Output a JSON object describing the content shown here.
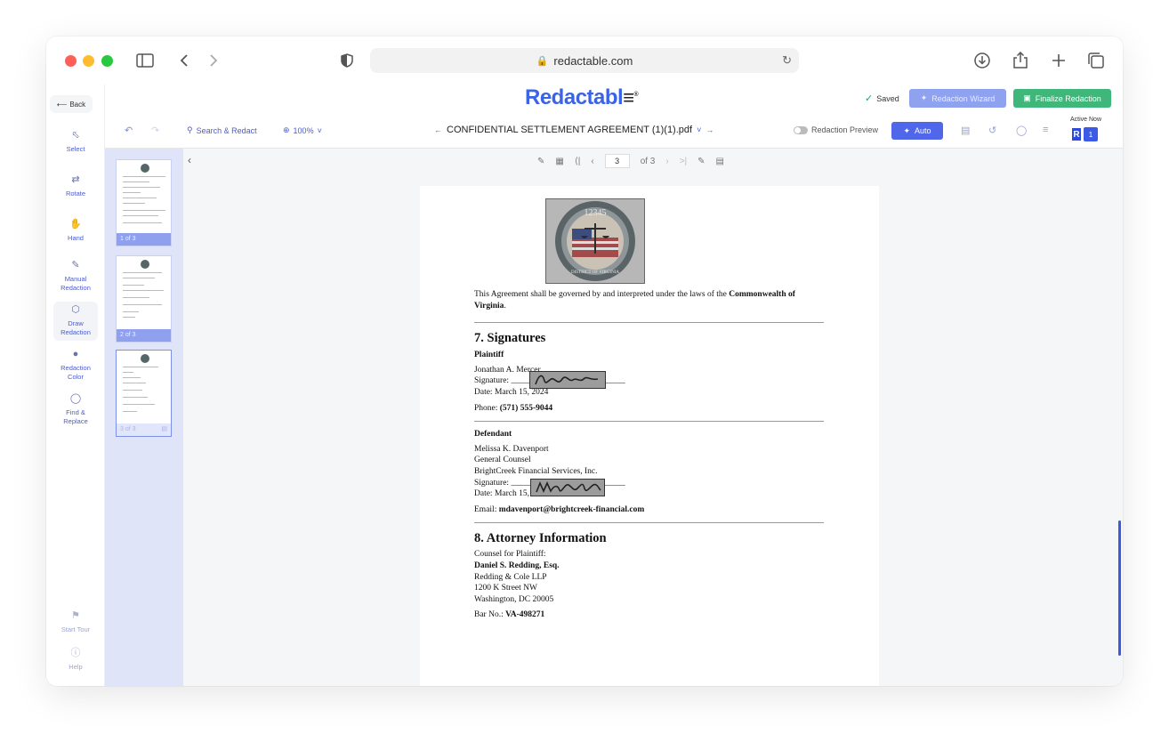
{
  "browser": {
    "url": "redactable.com"
  },
  "app": {
    "logo_text": "Redactabl",
    "logo_mark": "≡",
    "logo_reg": "®",
    "back_label": "Back",
    "saved_label": "Saved",
    "wizard_label": "Redaction Wizard",
    "finalize_label": "Finalize Redaction",
    "active_now_label": "Active Now",
    "avatar_initial": "R",
    "active_count": "1"
  },
  "tools": [
    {
      "label": "Select",
      "icon": "cursor-icon"
    },
    {
      "label": "Rotate",
      "icon": "rotate-icon"
    },
    {
      "label": "Hand",
      "icon": "hand-icon"
    },
    {
      "label": "Manual Redaction",
      "icon": "pen-icon"
    },
    {
      "label": "Draw Redaction",
      "icon": "cube-icon"
    },
    {
      "label": "Redaction Color",
      "icon": "palette-icon"
    },
    {
      "label": "Find & Replace",
      "icon": "find-replace-icon"
    }
  ],
  "rail_footer": {
    "tour_label": "Start Tour",
    "help_label": "Help"
  },
  "toolbar": {
    "search_label": "Search & Redact",
    "zoom_label": "100%",
    "document_title": "CONFIDENTIAL SETTLEMENT AGREEMENT (1)(1).pdf",
    "preview_label": "Redaction Preview",
    "auto_label": "Auto"
  },
  "pagination": {
    "current_page": "3",
    "of_label": "of 3"
  },
  "thumbnails": [
    {
      "label": "1 of 3"
    },
    {
      "label": "2 of 3"
    },
    {
      "label": "3 of 3"
    }
  ],
  "document": {
    "seal_text_top": "12345",
    "seal_text_bottom": "DISTRICT OF VIRGINIA",
    "gov_law_text": "This Agreement shall be governed by and interpreted under the laws of the ",
    "gov_law_bold": "Commonwealth of Virginia",
    "gov_law_end": ".",
    "sec7_heading": "7. Signatures",
    "plaintiff_label": "Plaintiff",
    "plaintiff_name": "Jonathan A. Mercer",
    "signature_label": "Signature: ",
    "signature_line": "___________________________",
    "plaintiff_date": "Date: March 15, 2024",
    "phone_label": "Phone: ",
    "phone_value": "(571) 555-9044",
    "defendant_label": "Defendant",
    "defendant_name": "Melissa K. Davenport",
    "defendant_title": "General Counsel",
    "defendant_company": "BrightCreek Financial Services, Inc.",
    "defendant_date": "Date: March 15, 2024",
    "email_label": "Email: ",
    "email_value": "mdavenport@brightcreek-financial.com",
    "sec8_heading": "8. Attorney Information",
    "counsel_label": "Counsel for Plaintiff:",
    "attorney_name": "Daniel S. Redding, Esq.",
    "firm": "Redding & Cole LLP",
    "street": "1200 K Street NW",
    "city": "Washington, DC 20005",
    "bar_label": "Bar No.: ",
    "bar_value": "VA-498271"
  },
  "colors": {
    "brand": "#3b63e6",
    "finalize": "#3fb77a",
    "wizard": "#8ea2ef",
    "thumb_panel": "#dfe4f9"
  }
}
